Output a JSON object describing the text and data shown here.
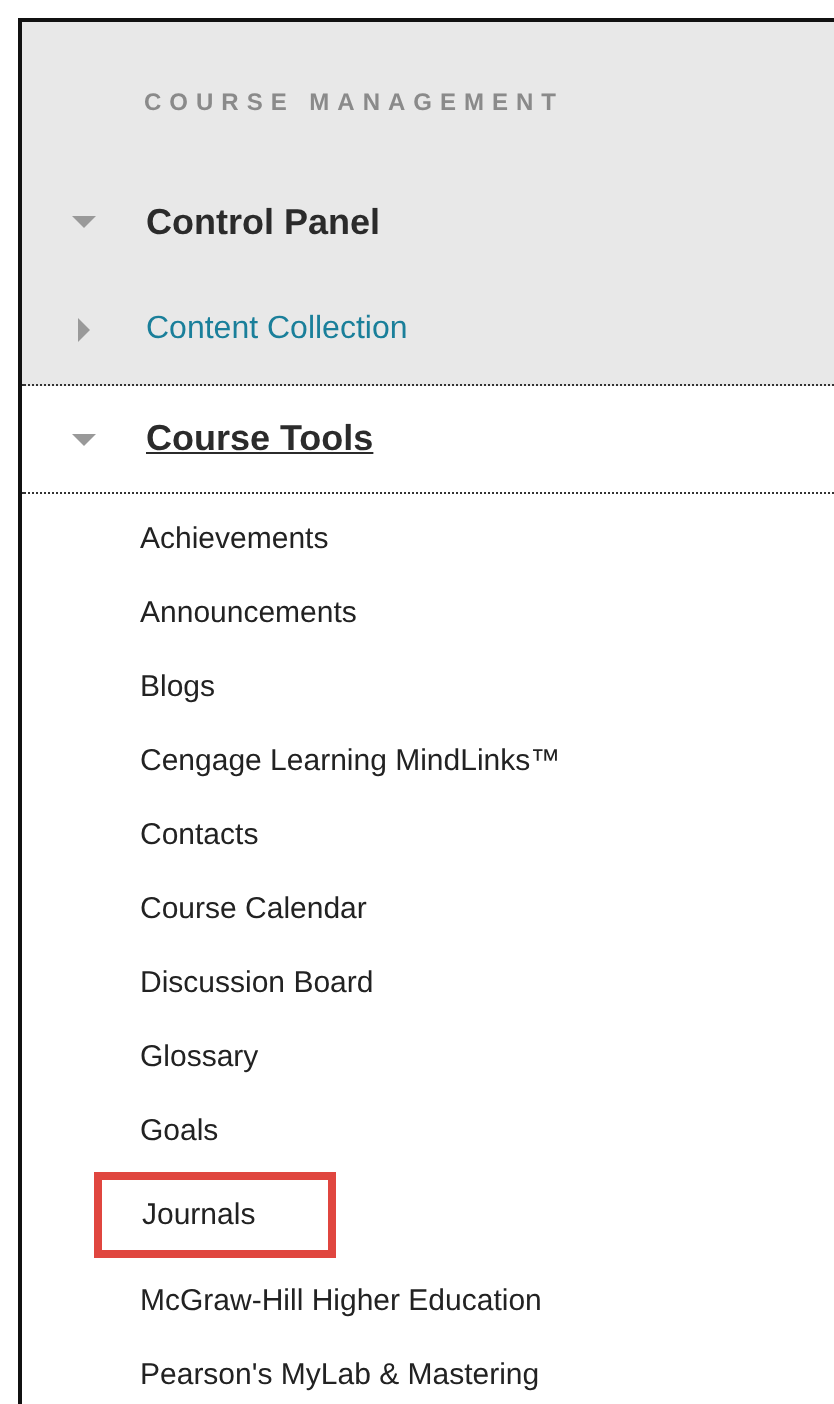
{
  "panel": {
    "heading": "COURSE MANAGEMENT",
    "sections": [
      {
        "label": "Control Panel",
        "kind": "title",
        "expanded": true
      },
      {
        "label": "Content Collection",
        "kind": "link",
        "expanded": false
      },
      {
        "label": "Course Tools",
        "kind": "tools",
        "expanded": true,
        "children": [
          {
            "label": "Achievements",
            "highlighted": false
          },
          {
            "label": "Announcements",
            "highlighted": false
          },
          {
            "label": "Blogs",
            "highlighted": false
          },
          {
            "label": "Cengage Learning MindLinks™",
            "highlighted": false
          },
          {
            "label": "Contacts",
            "highlighted": false
          },
          {
            "label": "Course Calendar",
            "highlighted": false
          },
          {
            "label": "Discussion Board",
            "highlighted": false
          },
          {
            "label": "Glossary",
            "highlighted": false
          },
          {
            "label": "Goals",
            "highlighted": false
          },
          {
            "label": "Journals",
            "highlighted": true
          },
          {
            "label": "McGraw-Hill Higher Education",
            "highlighted": false
          },
          {
            "label": "Pearson's MyLab & Mastering",
            "highlighted": false
          }
        ]
      }
    ]
  }
}
